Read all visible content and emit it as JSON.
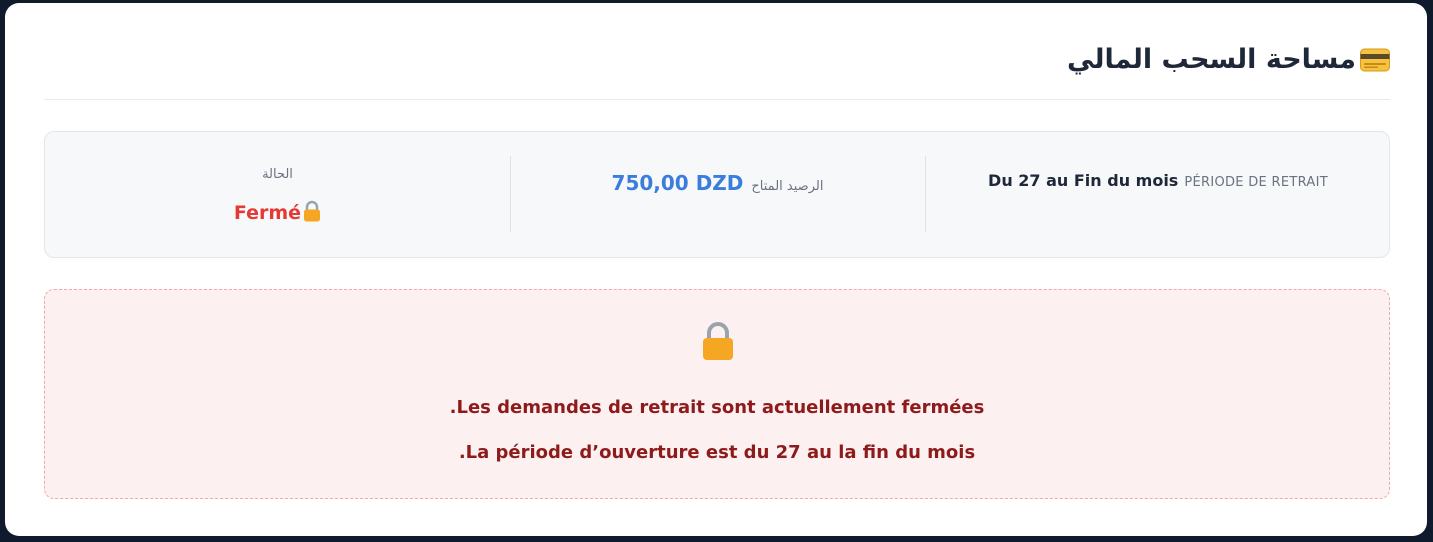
{
  "header": {
    "title": "مساحة السحب المالي",
    "icon": "credit-card-icon"
  },
  "info": {
    "status": {
      "label": "الحالة",
      "value": "Fermé",
      "icon": "lock-icon"
    },
    "balance": {
      "label": "الرصيد المتاح",
      "amount": "750,00 DZD"
    },
    "period": {
      "label": "PÉRIODE DE RETRAIT",
      "value": "Du 27 au Fin du mois"
    }
  },
  "alert": {
    "icon": "lock-icon",
    "line1": ".Les demandes de retrait sont actuellement fermées",
    "line2": ".La période d’ouverture est du 27 au la fin du mois"
  },
  "colors": {
    "background": "#0f1a2c",
    "status_closed": "#e53935",
    "balance": "#3b7ddd",
    "alert_text": "#8e1b1b",
    "alert_bg": "#fdf0f0",
    "lock": "#f5a623"
  }
}
